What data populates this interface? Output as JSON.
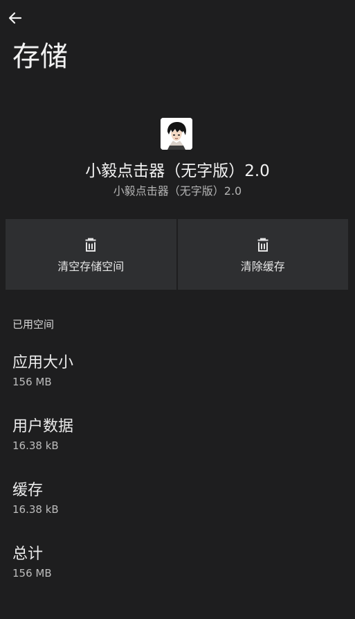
{
  "header": {
    "back_icon": "arrow-left-icon",
    "title": "存储"
  },
  "app": {
    "icon": "app-avatar-icon",
    "name": "小毅点击器（无字版）2.0",
    "subtitle": "小毅点击器（无字版）2.0"
  },
  "actions": [
    {
      "icon": "trash-icon",
      "label": "清空存储空间"
    },
    {
      "icon": "trash-icon",
      "label": "清除缓存"
    }
  ],
  "usage": {
    "section_title": "已用空间",
    "items": [
      {
        "title": "应用大小",
        "value": "156 MB"
      },
      {
        "title": "用户数据",
        "value": "16.38 kB"
      },
      {
        "title": "缓存",
        "value": "16.38 kB"
      },
      {
        "title": "总计",
        "value": "156 MB"
      }
    ]
  },
  "colors": {
    "background": "#1e1e1f",
    "button_surface": "#2e2f31",
    "text_primary": "#f2f2f2",
    "text_secondary": "#bdbdbd"
  }
}
